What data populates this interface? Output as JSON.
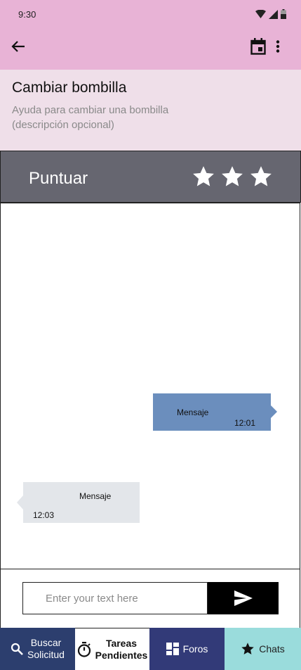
{
  "status_bar": {
    "time": "9:30",
    "icons": [
      "wifi-icon",
      "signal-icon",
      "battery-icon"
    ]
  },
  "app_bar": {
    "back_icon": "arrow-left-icon",
    "calendar_icon": "calendar-icon",
    "more_icon": "more-vertical-icon"
  },
  "task": {
    "title": "Cambiar bombilla",
    "description": "Ayuda para cambiar una bombilla (descripción opcional)"
  },
  "rating": {
    "label": "Puntuar",
    "stars": 3
  },
  "messages": [
    {
      "direction": "outgoing",
      "text": "Mensaje",
      "time": "12:01"
    },
    {
      "direction": "incoming",
      "text": "Mensaje",
      "time": "12:03"
    }
  ],
  "composer": {
    "placeholder": "Enter your text here",
    "value": "",
    "send_icon": "send-icon"
  },
  "bottom_nav": [
    {
      "label_line1": "Buscar",
      "label_line2": "Solicitud",
      "icon": "search-icon",
      "active": false
    },
    {
      "label_line1": "Tareas",
      "label_line2": "Pendientes",
      "icon": "timer-icon",
      "active": true
    },
    {
      "label_line1": "Foros",
      "label_line2": "",
      "icon": "dashboard-icon",
      "active": false
    },
    {
      "label_line1": "Chats",
      "label_line2": "",
      "icon": "star-icon",
      "active": false
    }
  ],
  "colors": {
    "app_bar": "#e8b3d6",
    "task_header": "#efdfe9",
    "rating_bar": "#666670",
    "outgoing_bubble": "#6b8ebd",
    "incoming_bubble": "#e3e6ea",
    "nav_search": "#2c3e6e",
    "nav_forums": "#323a78",
    "nav_chats": "#9adcdc"
  }
}
